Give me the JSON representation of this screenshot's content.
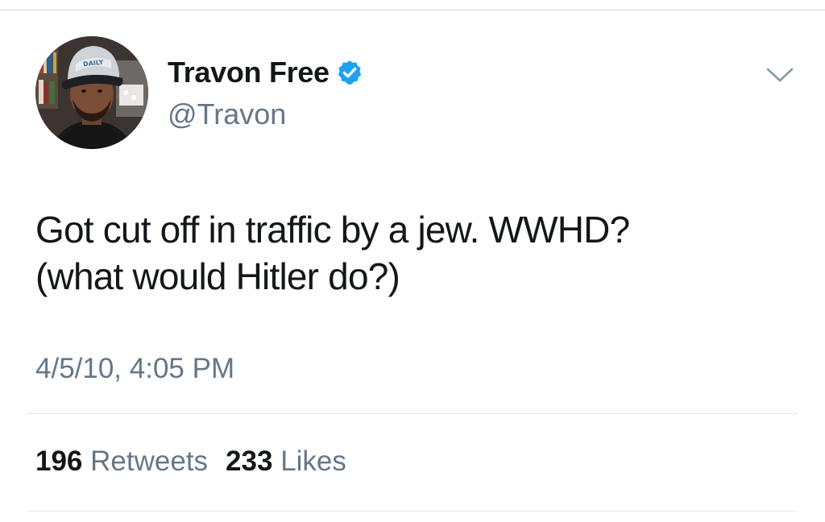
{
  "tweet": {
    "author": {
      "display_name": "Travon Free",
      "handle": "@Travon",
      "verified": true,
      "cap_text": "DAILY"
    },
    "text_lines": [
      "Got cut off in traffic by a jew. WWHD?",
      "(what would Hitler do?)"
    ],
    "timestamp": "4/5/10, 4:05 PM",
    "stats": {
      "retweets_count": "196",
      "retweets_label": "Retweets",
      "likes_count": "233",
      "likes_label": "Likes"
    }
  },
  "icons": {
    "verified": "verified-badge-icon",
    "menu": "chevron-down-icon"
  },
  "colors": {
    "text": "#14171a",
    "secondary": "#657786",
    "verified_blue": "#1da1f2",
    "divider": "#e1e8ed"
  }
}
